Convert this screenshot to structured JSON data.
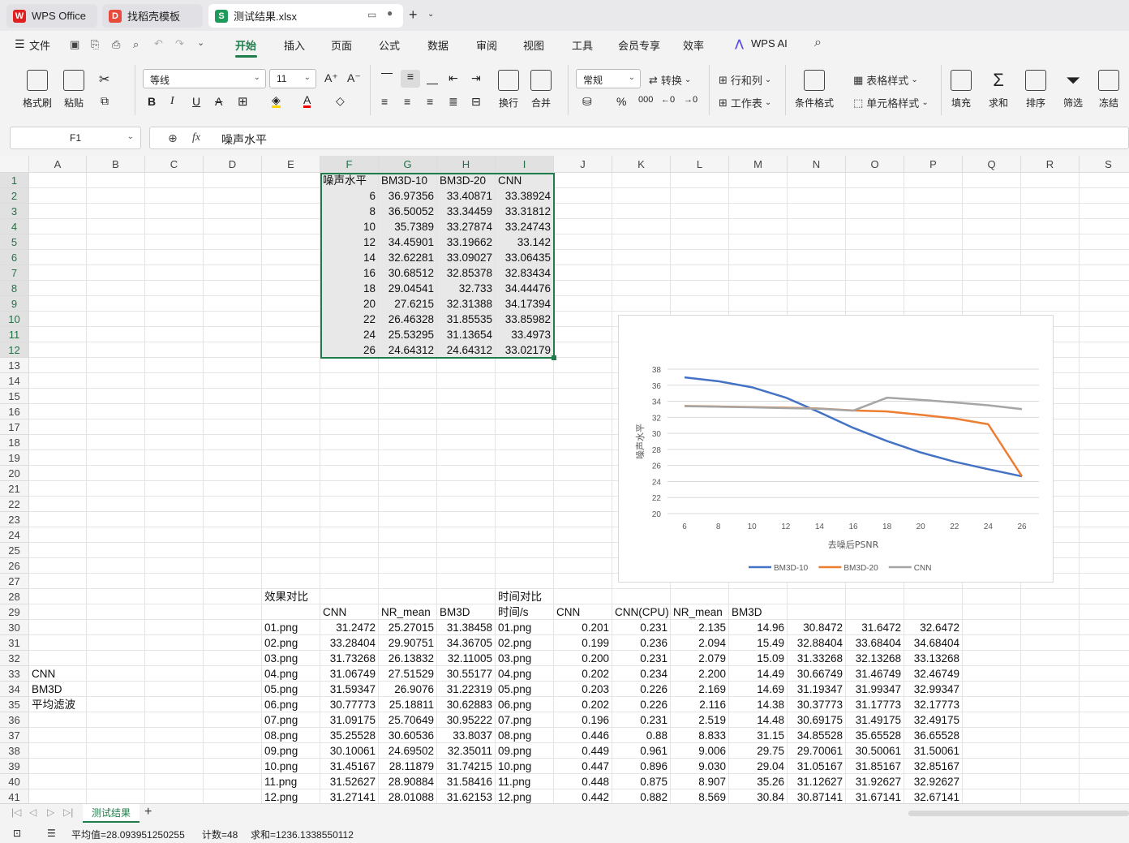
{
  "window_tabs": [
    {
      "label": "WPS Office",
      "icon": "wps-logo-icon"
    },
    {
      "label": "找稻壳模板",
      "icon": "docer-icon"
    },
    {
      "label": "测试结果.xlsx",
      "icon": "spreadsheet-icon",
      "active": true
    }
  ],
  "menu": {
    "file": "文件",
    "tabs": [
      "开始",
      "插入",
      "页面",
      "公式",
      "数据",
      "审阅",
      "视图",
      "工具",
      "会员专享",
      "效率",
      "WPS AI"
    ],
    "active_tab": "开始"
  },
  "ribbon": {
    "format_painter": "格式刷",
    "paste": "粘贴",
    "font_name": "等线",
    "font_size": "11",
    "wrap": "换行",
    "merge": "合并",
    "number_format": "常规",
    "convert": "转换",
    "row_col": "行和列",
    "worksheet": "工作表",
    "cond_format": "条件格式",
    "table_style": "表格样式",
    "cell_style": "单元格样式",
    "fill": "填充",
    "sum": "求和",
    "sort": "排序",
    "filter": "筛选",
    "freeze": "冻结"
  },
  "formula_bar": {
    "name_box": "F1",
    "fx": "fx",
    "content": "噪声水平"
  },
  "columns": [
    "A",
    "B",
    "C",
    "D",
    "E",
    "F",
    "G",
    "H",
    "I",
    "J",
    "K",
    "L",
    "M",
    "N",
    "O",
    "P",
    "Q",
    "R",
    "S"
  ],
  "rows": [
    "1",
    "2",
    "3",
    "4",
    "5",
    "6",
    "7",
    "8",
    "9",
    "10",
    "11",
    "12",
    "13",
    "14",
    "15",
    "16",
    "17",
    "18",
    "19",
    "20",
    "21",
    "22",
    "23",
    "24",
    "25",
    "26",
    "27",
    "28",
    "29",
    "30",
    "31",
    "32",
    "33",
    "34",
    "35",
    "36",
    "37",
    "38",
    "39",
    "40",
    "41"
  ],
  "table1": {
    "headers": [
      "噪声水平",
      "BM3D-10",
      "BM3D-20",
      "CNN"
    ],
    "rows": [
      [
        "6",
        "36.97356",
        "33.40871",
        "33.38924"
      ],
      [
        "8",
        "36.50052",
        "33.34459",
        "33.31812"
      ],
      [
        "10",
        "35.7389",
        "33.27874",
        "33.24743"
      ],
      [
        "12",
        "34.45901",
        "33.19662",
        "33.142"
      ],
      [
        "14",
        "32.62281",
        "33.09027",
        "33.06435"
      ],
      [
        "16",
        "30.68512",
        "32.85378",
        "32.83434"
      ],
      [
        "18",
        "29.04541",
        "32.733",
        "34.44476"
      ],
      [
        "20",
        "27.6215",
        "32.31388",
        "34.17394"
      ],
      [
        "22",
        "26.46328",
        "31.85535",
        "33.85982"
      ],
      [
        "24",
        "25.53295",
        "31.13654",
        "33.4973"
      ],
      [
        "26",
        "24.64312",
        "24.64312",
        "33.02179"
      ]
    ]
  },
  "side_labels": [
    "CNN",
    "BM3D",
    "平均滤波"
  ],
  "table2": {
    "title_effect": "效果对比",
    "title_time": "时间对比",
    "headers": [
      "CNN",
      "NR_mean",
      "BM3D",
      "时间/s",
      "CNN",
      "CNN(CPU)",
      "NR_mean",
      "BM3D"
    ],
    "rows": [
      [
        "01.png",
        "31.2472",
        "25.27015",
        "31.38458",
        "01.png",
        "0.201",
        "0.231",
        "2.135",
        "14.96",
        "30.8472",
        "31.6472",
        "32.6472"
      ],
      [
        "02.png",
        "33.28404",
        "29.90751",
        "34.36705",
        "02.png",
        "0.199",
        "0.236",
        "2.094",
        "15.49",
        "32.88404",
        "33.68404",
        "34.68404"
      ],
      [
        "03.png",
        "31.73268",
        "26.13832",
        "32.11005",
        "03.png",
        "0.200",
        "0.231",
        "2.079",
        "15.09",
        "31.33268",
        "32.13268",
        "33.13268"
      ],
      [
        "04.png",
        "31.06749",
        "27.51529",
        "30.55177",
        "04.png",
        "0.202",
        "0.234",
        "2.200",
        "14.49",
        "30.66749",
        "31.46749",
        "32.46749"
      ],
      [
        "05.png",
        "31.59347",
        "26.9076",
        "31.22319",
        "05.png",
        "0.203",
        "0.226",
        "2.169",
        "14.69",
        "31.19347",
        "31.99347",
        "32.99347"
      ],
      [
        "06.png",
        "30.77773",
        "25.18811",
        "30.62883",
        "06.png",
        "0.202",
        "0.226",
        "2.116",
        "14.38",
        "30.37773",
        "31.17773",
        "32.17773"
      ],
      [
        "07.png",
        "31.09175",
        "25.70649",
        "30.95222",
        "07.png",
        "0.196",
        "0.231",
        "2.519",
        "14.48",
        "30.69175",
        "31.49175",
        "32.49175"
      ],
      [
        "08.png",
        "35.25528",
        "30.60536",
        "33.8037",
        "08.png",
        "0.446",
        "0.88",
        "8.833",
        "31.15",
        "34.85528",
        "35.65528",
        "36.65528"
      ],
      [
        "09.png",
        "30.10061",
        "24.69502",
        "32.35011",
        "09.png",
        "0.449",
        "0.961",
        "9.006",
        "29.75",
        "29.70061",
        "30.50061",
        "31.50061"
      ],
      [
        "10.png",
        "31.45167",
        "28.11879",
        "31.74215",
        "10.png",
        "0.447",
        "0.896",
        "9.030",
        "29.04",
        "31.05167",
        "31.85167",
        "32.85167"
      ],
      [
        "11.png",
        "31.52627",
        "28.90884",
        "31.58416",
        "11.png",
        "0.448",
        "0.875",
        "8.907",
        "35.26",
        "31.12627",
        "31.92627",
        "32.92627"
      ],
      [
        "12.png",
        "31.27141",
        "28.01088",
        "31.62153",
        "12.png",
        "0.442",
        "0.882",
        "8.569",
        "30.84",
        "30.87141",
        "31.67141",
        "32.67141"
      ]
    ]
  },
  "chart_data": {
    "type": "line",
    "title": "",
    "xlabel": "去噪后PSNR",
    "ylabel": "噪声水平",
    "categories": [
      "6",
      "8",
      "10",
      "12",
      "14",
      "16",
      "18",
      "20",
      "22",
      "24",
      "26"
    ],
    "ylim": [
      20,
      38
    ],
    "yticks": [
      "38",
      "36",
      "34",
      "32",
      "30",
      "28",
      "26",
      "24",
      "22",
      "20"
    ],
    "grid": true,
    "legend": "bottom",
    "series": [
      {
        "name": "BM3D-10",
        "color": "#4472c4",
        "values": [
          36.97356,
          36.50052,
          35.7389,
          34.45901,
          32.62281,
          30.68512,
          29.04541,
          27.6215,
          26.46328,
          25.53295,
          24.64312
        ]
      },
      {
        "name": "BM3D-20",
        "color": "#ed7d31",
        "values": [
          33.40871,
          33.34459,
          33.27874,
          33.19662,
          33.09027,
          32.85378,
          32.733,
          32.31388,
          31.85535,
          31.13654,
          24.64312
        ]
      },
      {
        "name": "CNN",
        "color": "#a5a5a5",
        "values": [
          33.38924,
          33.31812,
          33.24743,
          33.142,
          33.06435,
          32.83434,
          34.44476,
          34.17394,
          33.85982,
          33.4973,
          33.02179
        ]
      }
    ]
  },
  "sheet_tabs": {
    "active": "测试结果",
    "add": "+"
  },
  "status": {
    "average": "平均值=28.093951250255",
    "count": "计数=48",
    "sum": "求和=1236.1338550112"
  }
}
